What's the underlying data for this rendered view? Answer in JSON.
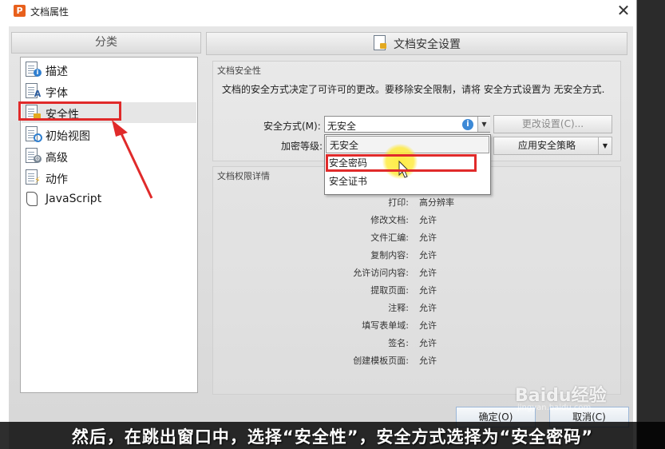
{
  "window": {
    "title": "文档属性",
    "close_icon": "close-icon"
  },
  "category_panel": {
    "header": "分类",
    "items": [
      {
        "label": "描述",
        "icon": "info-doc-icon"
      },
      {
        "label": "字体",
        "icon": "font-doc-icon"
      },
      {
        "label": "安全性",
        "icon": "lock-doc-icon",
        "selected": true
      },
      {
        "label": "初始视图",
        "icon": "view-doc-icon"
      },
      {
        "label": "高级",
        "icon": "gear-doc-icon"
      },
      {
        "label": "动作",
        "icon": "action-doc-icon"
      },
      {
        "label": "JavaScript",
        "icon": "script-icon"
      }
    ]
  },
  "security_panel": {
    "header": "文档安全设置",
    "group_security": {
      "label": "文档安全性",
      "description": "文档的安全方式决定了可许可的更改。要移除安全限制，请将 安全方式设置为 无安全方式.",
      "method_label": "安全方式(M):",
      "method_value": "无安全",
      "level_label": "加密等级:",
      "change_settings_button": "更改设置(C)...",
      "apply_policy_button": "应用安全策略",
      "dropdown_options": [
        "无安全",
        "安全密码",
        "安全证书"
      ]
    },
    "group_permissions": {
      "label": "文档权限详情",
      "rows": [
        {
          "key": "打印:",
          "value": "高分辨率"
        },
        {
          "key": "修改文档:",
          "value": "允许"
        },
        {
          "key": "文件汇编:",
          "value": "允许"
        },
        {
          "key": "复制内容:",
          "value": "允许"
        },
        {
          "key": "允许访问内容:",
          "value": "允许"
        },
        {
          "key": "提取页面:",
          "value": "允许"
        },
        {
          "key": "注释:",
          "value": "允许"
        },
        {
          "key": "填写表单域:",
          "value": "允许"
        },
        {
          "key": "签名:",
          "value": "允许"
        },
        {
          "key": "创建模板页面:",
          "value": "允许"
        }
      ]
    }
  },
  "footer": {
    "ok_button": "确定(O)",
    "cancel_button": "取消(C)"
  },
  "watermark": {
    "brand": "Baidu经验",
    "sub": "jingyan.baidu.com"
  },
  "caption": "然后，在跳出窗口中，选择“安全性”，安全方式选择为“安全密码”",
  "colors": {
    "highlight_red": "#e02a2a",
    "cursor_yellow": "#ffe83c",
    "info_blue": "#3c89d6"
  }
}
